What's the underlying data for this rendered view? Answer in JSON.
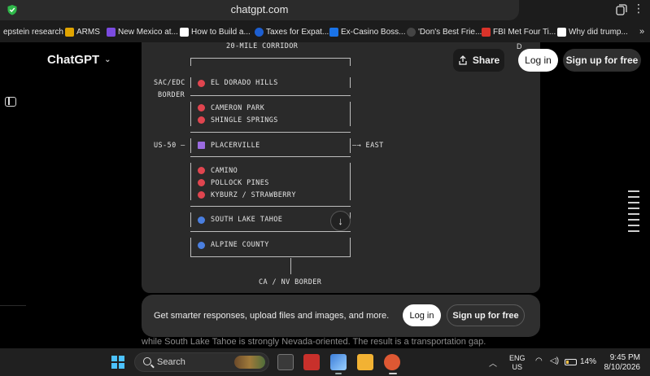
{
  "browser": {
    "url": "chatgpt.com",
    "bookmarks": [
      {
        "label": "epstein research",
        "color": "#2b2b2b"
      },
      {
        "label": "ARMS",
        "color": "#e0a400"
      },
      {
        "label": "New Mexico at...",
        "color": "#7b4be0"
      },
      {
        "label": "How to Build a...",
        "color": "#ffffff"
      },
      {
        "label": "Taxes for Expat...",
        "color": "#1d5fd1"
      },
      {
        "label": "Ex-Casino Boss...",
        "color": "#1a73e8"
      },
      {
        "label": "'Don's Best Frie...",
        "color": "#444444"
      },
      {
        "label": "FBI Met Four Ti...",
        "color": "#d9332a"
      },
      {
        "label": "Why did trump...",
        "color": "#ffffff"
      }
    ],
    "more_bookmarks": "»"
  },
  "header": {
    "brand": "ChatGPT",
    "share_label": "Share",
    "login_label": "Log in",
    "signup_label": "Sign up for free"
  },
  "diagram": {
    "title": "20-MILE CORRIDOR",
    "left_labels": {
      "sac": "SAC/EDC",
      "border": "BORDER",
      "us50": "US-50 —"
    },
    "east_label": "—→ EAST",
    "bottom_label": "CA / NV BORDER",
    "corner_glyph": "D",
    "stops": [
      {
        "label": "EL DORADO HILLS",
        "marker": "red"
      },
      {
        "label": "CAMERON PARK",
        "marker": "red"
      },
      {
        "label": "SHINGLE SPRINGS",
        "marker": "red"
      },
      {
        "label": "PLACERVILLE",
        "marker": "purple-square"
      },
      {
        "label": "CAMINO",
        "marker": "red"
      },
      {
        "label": "POLLOCK PINES",
        "marker": "red"
      },
      {
        "label": "KYBURZ / STRAWBERRY",
        "marker": "red"
      },
      {
        "label": "SOUTH LAKE TAHOE",
        "marker": "blue"
      },
      {
        "label": "ALPINE COUNTY",
        "marker": "blue"
      }
    ],
    "colors": {
      "red": "#e0454f",
      "blue": "#4a7fe0",
      "purple": "#9b6be0"
    }
  },
  "banner": {
    "text": "Get smarter responses, upload files and images, and more.",
    "login_label": "Log in",
    "signup_label": "Sign up for free",
    "partial_text_behind": "while South Lake Tahoe is strongly Nevada-oriented. The result is a transportation gap."
  },
  "taskbar": {
    "search_label": "Search",
    "lang_line1": "ENG",
    "lang_line2": "US",
    "battery": "14%",
    "time": "9:45 PM",
    "date": "8/10/2026"
  }
}
